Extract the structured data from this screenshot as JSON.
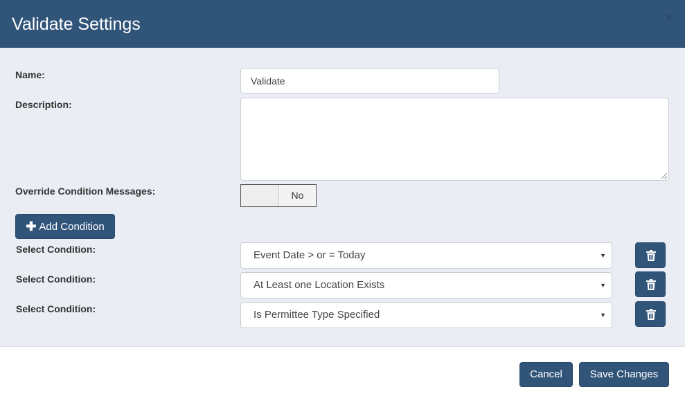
{
  "dialog": {
    "title": "Validate Settings",
    "close_glyph": "×"
  },
  "form": {
    "name_label": "Name:",
    "name_value": "Validate",
    "description_label": "Description:",
    "description_value": "",
    "override_label": "Override Condition Messages:",
    "override_state": "No",
    "add_condition_label": "Add Condition",
    "add_condition_icon": "plus-icon"
  },
  "conditions": [
    {
      "label": "Select Condition:",
      "value": "Event Date > or = Today"
    },
    {
      "label": "Select Condition:",
      "value": "At Least one Location Exists"
    },
    {
      "label": "Select Condition:",
      "value": "Is Permittee Type Specified"
    }
  ],
  "footer": {
    "cancel_label": "Cancel",
    "save_label": "Save Changes"
  },
  "colors": {
    "header_bg": "#315479",
    "body_bg": "#eaedf3",
    "button_bg": "#315479"
  }
}
